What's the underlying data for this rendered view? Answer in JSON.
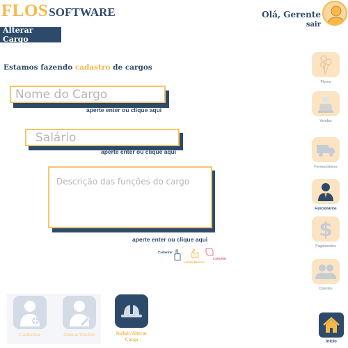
{
  "app": {
    "logo_main": "FLOS",
    "logo_sub": "SOFTWARE"
  },
  "header": {
    "greeting": "Olá, Gerente",
    "logout": "sair"
  },
  "page": {
    "tab_title": "Alterar Cargo",
    "intro_before": "Estamos fazendo ",
    "intro_highlight": "cadastro",
    "intro_after": " de cargos"
  },
  "form": {
    "name_placeholder": "Nome do Cargo",
    "name_hint": "aperte enter ou clique aqui",
    "salary_placeholder": "Salário",
    "salary_hint": "aperte enter ou clique aqui",
    "description_placeholder": "Descrição das funções do cargo",
    "description_hint": "aperte enter ou clique aqui",
    "mini_actions": [
      {
        "label": "Cadastrar",
        "icon": "hand-icon"
      },
      {
        "label": "Listar/ Buscar",
        "icon": "hand-point-icon"
      },
      {
        "label": "Cancelar",
        "icon": "hand-cancel-icon"
      }
    ]
  },
  "sidebar": {
    "items": [
      {
        "label": "Flores",
        "icon": "flower-icon"
      },
      {
        "label": "Vendas",
        "icon": "cash-register-icon"
      },
      {
        "label": "Fornecedores",
        "icon": "truck-icon"
      },
      {
        "label": "Funcionários",
        "icon": "employee-icon"
      },
      {
        "label": "Pagamentos",
        "icon": "dollar-icon"
      },
      {
        "label": "Clientes",
        "icon": "users-icon"
      }
    ],
    "home_label": "Inicio"
  },
  "bottom": {
    "items": [
      {
        "label": "Cadastrar",
        "icon": "user-add-icon"
      },
      {
        "label": "Alterar/Excluir",
        "icon": "user-edit-icon"
      },
      {
        "label": "Incluir/Alterar Cargo",
        "icon": "hard-hat-icon"
      }
    ]
  },
  "colors": {
    "navy": "#2e4a6b",
    "accent": "#f5b94a",
    "accent_light": "#fce4c3",
    "disabled": "#d3dbe6",
    "cancel": "#e0506a"
  }
}
